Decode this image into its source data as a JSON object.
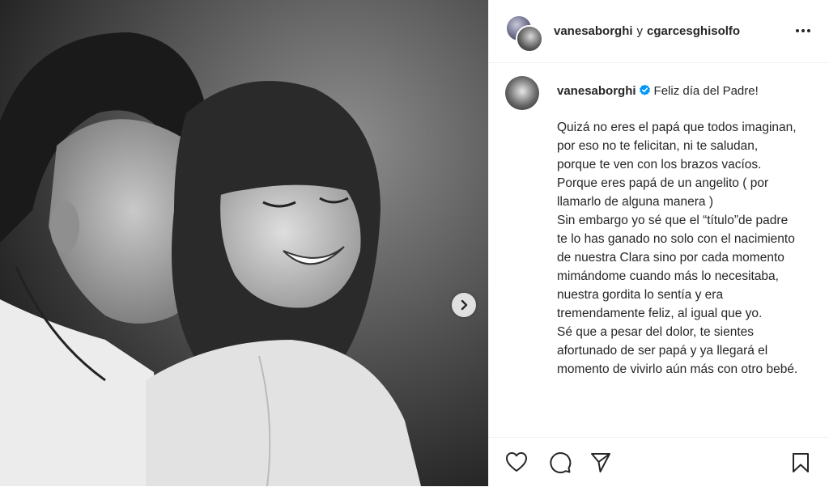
{
  "post": {
    "photo_alt": "Black and white photo of a smiling couple",
    "header": {
      "user1": "vanesaborghi",
      "separator": "y",
      "user2": "cgarcesghisolfo"
    },
    "caption": {
      "username": "vanesaborghi",
      "first_line": "Feliz día del Padre!",
      "body": "Quizá no eres el papá que todos imaginan, por eso no te felicitan, ni te saludan, porque te ven con los brazos vacíos. Porque eres papá de un angelito ( por llamarlo de alguna manera )\nSin embargo yo sé que el “título”de padre te lo has ganado no solo con el nacimiento de nuestra Clara sino por cada momento mimándome cuando más lo necesitaba, nuestra gordita lo sentía y era tremendamente feliz, al igual que yo.\nSé que a pesar del dolor, te sientes afortunado de ser papá y ya llegará el momento de vivirlo aún más con otro bebé."
    }
  },
  "icons": {
    "more": "more-options-icon",
    "verified": "verified-badge-icon",
    "next": "chevron-right-icon",
    "like": "heart-icon",
    "comment": "comment-icon",
    "share": "share-icon",
    "save": "bookmark-icon"
  },
  "colors": {
    "text": "#262626",
    "verified": "#0095f6",
    "border": "#efefef"
  }
}
